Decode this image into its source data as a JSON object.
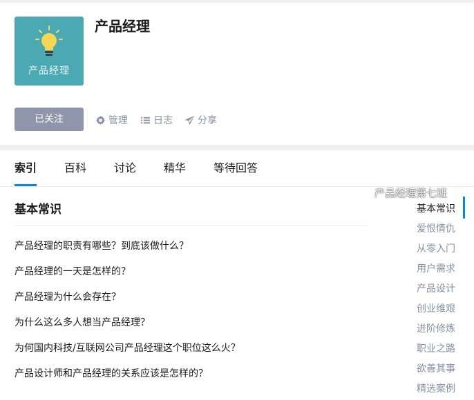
{
  "topic": {
    "title": "产品经理",
    "avatar_label": "产品经理",
    "avatar_color": "#4aa9b3"
  },
  "actions": {
    "follow_label": "已关注",
    "manage_label": "管理",
    "log_label": "日志",
    "share_label": "分享"
  },
  "tabs": [
    {
      "label": "索引",
      "active": true
    },
    {
      "label": "百科"
    },
    {
      "label": "讨论"
    },
    {
      "label": "精华"
    },
    {
      "label": "等待回答"
    }
  ],
  "section": {
    "title": "基本常识",
    "questions": [
      "产品经理的职责有哪些？到底该做什么？",
      "产品经理的一天是怎样的？",
      "产品经理为什么会存在？",
      "为什么这么多人想当产品经理？",
      "为何国内科技/互联网公司产品经理这个职位这么火？",
      "产品设计师和产品经理的关系应该是怎样的？"
    ]
  },
  "side_nav": [
    {
      "label": "基本常识",
      "active": true
    },
    {
      "label": "爱恨情仇"
    },
    {
      "label": "从零入门"
    },
    {
      "label": "用户需求"
    },
    {
      "label": "产品设计"
    },
    {
      "label": "创业维艰"
    },
    {
      "label": "进阶修炼"
    },
    {
      "label": "职业之路"
    },
    {
      "label": "欲善其事"
    },
    {
      "label": "精选案例"
    }
  ],
  "watermark": {
    "text": "产品经理第七班",
    "icon": "wechat-icon"
  },
  "colors": {
    "accent": "#0084ff",
    "follow_button": "#8f96ab",
    "muted_text": "#8590a6"
  }
}
